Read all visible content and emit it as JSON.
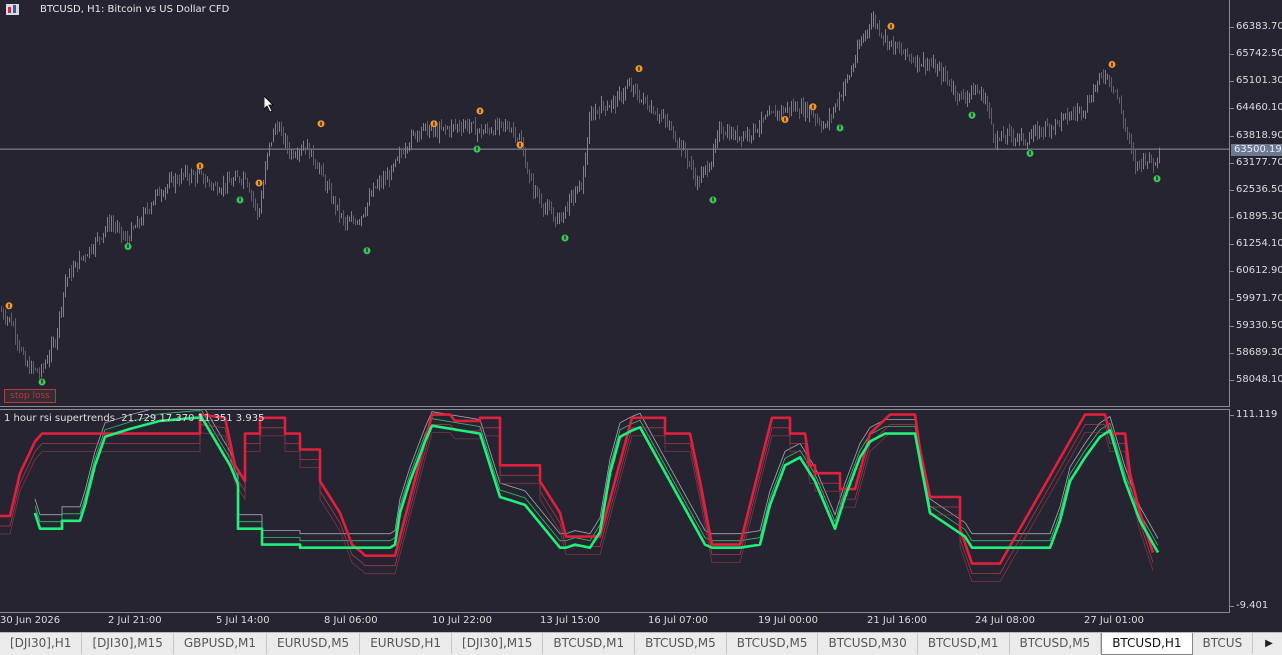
{
  "symbol": "BTCUSD",
  "timeframe": "H1",
  "title": "BTCUSD, H1:  Bitcoin vs US Dollar CFD",
  "indicator": {
    "name": "1 hour rsi supertrends",
    "values": "21.729 17.370 11.351 3.935",
    "axis_top": "111.119",
    "axis_bottom": "-9.401"
  },
  "stop_label": "stop loss",
  "current_price": "63500.19",
  "colors": {
    "bg": "#262431",
    "bull": "#2faf6a",
    "bear": "#c8304a",
    "super_up": "#1ef07a",
    "super_down": "#e0203e",
    "up_arrow": "#3ec65a",
    "down_arrow": "#f09a28",
    "grid": "#8a8a92"
  },
  "price_axis": [
    "66383.70",
    "65742.50",
    "65101.30",
    "64460.10",
    "63818.90",
    "63177.70",
    "62536.50",
    "61895.30",
    "61254.10",
    "60612.90",
    "59971.70",
    "59330.50",
    "58689.30",
    "58048.10"
  ],
  "time_axis": [
    "30 Jun 2026",
    "2 Jul 21:00",
    "5 Jul 14:00",
    "8 Jul 06:00",
    "10 Jul 22:00",
    "13 Jul 15:00",
    "16 Jul 07:00",
    "19 Jul 00:00",
    "21 Jul 16:00",
    "24 Jul 08:00",
    "27 Jul 01:00"
  ],
  "tabs": [
    "[DJI30],H1",
    "[DJI30],M15",
    "GBPUSD,M1",
    "EURUSD,M5",
    "EURUSD,H1",
    "[DJI30],M15",
    "BTCUSD,M1",
    "BTCUSD,M5",
    "BTCUSD,M5",
    "BTCUSD,M30",
    "BTCUSD,M1",
    "BTCUSD,M5",
    "BTCUSD,H1",
    "BTCUS"
  ],
  "active_tab": 12,
  "chart_data": {
    "type": "candlestick",
    "title": "BTCUSD, H1:  Bitcoin vs US Dollar CFD",
    "ylim": [
      57700,
      66900
    ],
    "current_price": 63500.19,
    "close_path": [
      [
        0,
        59700
      ],
      [
        12,
        59400
      ],
      [
        25,
        58400
      ],
      [
        40,
        58200
      ],
      [
        55,
        59000
      ],
      [
        65,
        60400
      ],
      [
        80,
        60900
      ],
      [
        95,
        61300
      ],
      [
        110,
        61800
      ],
      [
        125,
        61350
      ],
      [
        140,
        61800
      ],
      [
        155,
        62400
      ],
      [
        170,
        62700
      ],
      [
        185,
        62900
      ],
      [
        200,
        62850
      ],
      [
        215,
        62600
      ],
      [
        230,
        62700
      ],
      [
        245,
        62900
      ],
      [
        258,
        61900
      ],
      [
        268,
        63500
      ],
      [
        276,
        64100
      ],
      [
        290,
        63400
      ],
      [
        305,
        63600
      ],
      [
        318,
        63100
      ],
      [
        330,
        62400
      ],
      [
        345,
        61700
      ],
      [
        360,
        61900
      ],
      [
        375,
        62600
      ],
      [
        390,
        62900
      ],
      [
        405,
        63600
      ],
      [
        420,
        64000
      ],
      [
        435,
        63900
      ],
      [
        450,
        64000
      ],
      [
        465,
        64100
      ],
      [
        480,
        63900
      ],
      [
        495,
        64000
      ],
      [
        510,
        64050
      ],
      [
        520,
        63700
      ],
      [
        530,
        62700
      ],
      [
        545,
        62100
      ],
      [
        558,
        61800
      ],
      [
        570,
        62300
      ],
      [
        582,
        62700
      ],
      [
        590,
        64300
      ],
      [
        600,
        64500
      ],
      [
        615,
        64600
      ],
      [
        628,
        65000
      ],
      [
        640,
        64700
      ],
      [
        655,
        64400
      ],
      [
        670,
        64000
      ],
      [
        685,
        63400
      ],
      [
        697,
        62700
      ],
      [
        712,
        63300
      ],
      [
        720,
        64000
      ],
      [
        735,
        63800
      ],
      [
        750,
        63900
      ],
      [
        765,
        64200
      ],
      [
        780,
        64400
      ],
      [
        795,
        64500
      ],
      [
        810,
        64400
      ],
      [
        825,
        64000
      ],
      [
        838,
        64700
      ],
      [
        850,
        65300
      ],
      [
        860,
        66000
      ],
      [
        872,
        66600
      ],
      [
        885,
        66100
      ],
      [
        900,
        65800
      ],
      [
        915,
        65600
      ],
      [
        930,
        65500
      ],
      [
        945,
        65200
      ],
      [
        960,
        64700
      ],
      [
        975,
        64900
      ],
      [
        985,
        64700
      ],
      [
        995,
        63700
      ],
      [
        1010,
        63850
      ],
      [
        1025,
        63700
      ],
      [
        1040,
        63950
      ],
      [
        1055,
        64100
      ],
      [
        1070,
        64300
      ],
      [
        1085,
        64500
      ],
      [
        1095,
        65000
      ],
      [
        1105,
        65300
      ],
      [
        1115,
        64900
      ],
      [
        1125,
        64000
      ],
      [
        1135,
        63100
      ],
      [
        1145,
        63300
      ],
      [
        1155,
        63150
      ],
      [
        1160,
        63700
      ]
    ],
    "up_arrows": [
      [
        42,
        58000
      ],
      [
        128,
        61200
      ],
      [
        240,
        62300
      ],
      [
        367,
        61100
      ],
      [
        477,
        63500
      ],
      [
        565,
        61400
      ],
      [
        713,
        62300
      ],
      [
        840,
        64000
      ],
      [
        972,
        64300
      ],
      [
        1030,
        63400
      ],
      [
        1157,
        62800
      ]
    ],
    "down_arrows": [
      [
        9,
        59800
      ],
      [
        200,
        63100
      ],
      [
        259,
        62700
      ],
      [
        321,
        64100
      ],
      [
        434,
        64100
      ],
      [
        480,
        64400
      ],
      [
        520,
        63600
      ],
      [
        639,
        65400
      ],
      [
        785,
        64200
      ],
      [
        813,
        64500
      ],
      [
        891,
        66400
      ],
      [
        1112,
        65500
      ]
    ],
    "indicator": {
      "ylim": [
        -9.401,
        111.119
      ],
      "super_down": [
        [
          0,
          48
        ],
        [
          10,
          48
        ],
        [
          20,
          75
        ],
        [
          35,
          95
        ],
        [
          42,
          100
        ],
        [
          45,
          100
        ],
        [
          45,
          100
        ],
        [
          200,
          100
        ],
        [
          200,
          112
        ],
        [
          225,
          110
        ],
        [
          235,
          80
        ],
        [
          245,
          70
        ],
        [
          245,
          100
        ],
        [
          260,
          100
        ],
        [
          260,
          110
        ],
        [
          285,
          110
        ],
        [
          285,
          100
        ],
        [
          300,
          100
        ],
        [
          300,
          90
        ],
        [
          320,
          90
        ],
        [
          320,
          70
        ],
        [
          330,
          60
        ],
        [
          340,
          50
        ],
        [
          352,
          30
        ],
        [
          362,
          25
        ],
        [
          365,
          23
        ],
        [
          365,
          23
        ],
        [
          380,
          23
        ],
        [
          395,
          23
        ],
        [
          432,
          112
        ],
        [
          450,
          112
        ],
        [
          455,
          108
        ],
        [
          480,
          108
        ],
        [
          480,
          110
        ],
        [
          500,
          110
        ],
        [
          500,
          80
        ],
        [
          540,
          80
        ],
        [
          540,
          70
        ],
        [
          560,
          50
        ],
        [
          566,
          35
        ],
        [
          566,
          35
        ],
        [
          600,
          35
        ],
        [
          632,
          110
        ],
        [
          665,
          110
        ],
        [
          665,
          100
        ],
        [
          690,
          100
        ],
        [
          700,
          70
        ],
        [
          712,
          30
        ],
        [
          712,
          30
        ],
        [
          740,
          30
        ],
        [
          772,
          110
        ],
        [
          790,
          110
        ],
        [
          790,
          100
        ],
        [
          805,
          100
        ],
        [
          810,
          80
        ],
        [
          815,
          80
        ],
        [
          815,
          75
        ],
        [
          840,
          75
        ],
        [
          840,
          65
        ],
        [
          855,
          65
        ],
        [
          870,
          100
        ],
        [
          890,
          112
        ],
        [
          915,
          112
        ],
        [
          920,
          90
        ],
        [
          930,
          60
        ],
        [
          960,
          60
        ],
        [
          960,
          40
        ],
        [
          972,
          18
        ],
        [
          972,
          18
        ],
        [
          1000,
          18
        ],
        [
          1085,
          112
        ],
        [
          1105,
          112
        ],
        [
          1110,
          100
        ],
        [
          1125,
          100
        ],
        [
          1130,
          75
        ],
        [
          1140,
          50
        ],
        [
          1153,
          25
        ]
      ],
      "super_up": [
        [
          35,
          50
        ],
        [
          40,
          40
        ],
        [
          40,
          40
        ],
        [
          62,
          40
        ],
        [
          62,
          45
        ],
        [
          80,
          45
        ],
        [
          85,
          55
        ],
        [
          95,
          80
        ],
        [
          105,
          98
        ],
        [
          130,
          103
        ],
        [
          160,
          108
        ],
        [
          195,
          110
        ],
        [
          200,
          110
        ],
        [
          200,
          112
        ],
        [
          230,
          80
        ],
        [
          238,
          68
        ],
        [
          238,
          40
        ],
        [
          262,
          40
        ],
        [
          262,
          30
        ],
        [
          300,
          30
        ],
        [
          300,
          28
        ],
        [
          362,
          28
        ],
        [
          368,
          28
        ],
        [
          390,
          28
        ],
        [
          395,
          30
        ],
        [
          400,
          50
        ],
        [
          410,
          70
        ],
        [
          425,
          95
        ],
        [
          432,
          105
        ],
        [
          480,
          100
        ],
        [
          500,
          60
        ],
        [
          525,
          55
        ],
        [
          560,
          28
        ],
        [
          566,
          28
        ],
        [
          575,
          30
        ],
        [
          590,
          28
        ],
        [
          600,
          38
        ],
        [
          610,
          75
        ],
        [
          620,
          98
        ],
        [
          632,
          102
        ],
        [
          640,
          104
        ],
        [
          705,
          30
        ],
        [
          712,
          28
        ],
        [
          740,
          28
        ],
        [
          760,
          30
        ],
        [
          770,
          55
        ],
        [
          785,
          80
        ],
        [
          800,
          85
        ],
        [
          815,
          70
        ],
        [
          825,
          55
        ],
        [
          835,
          40
        ],
        [
          845,
          60
        ],
        [
          860,
          85
        ],
        [
          870,
          95
        ],
        [
          885,
          100
        ],
        [
          915,
          100
        ],
        [
          930,
          50
        ],
        [
          965,
          35
        ],
        [
          972,
          28
        ],
        [
          1000,
          28
        ],
        [
          1050,
          28
        ],
        [
          1060,
          45
        ],
        [
          1070,
          70
        ],
        [
          1085,
          85
        ],
        [
          1100,
          98
        ],
        [
          1110,
          102
        ],
        [
          1125,
          70
        ],
        [
          1140,
          45
        ],
        [
          1158,
          25
        ]
      ]
    }
  }
}
